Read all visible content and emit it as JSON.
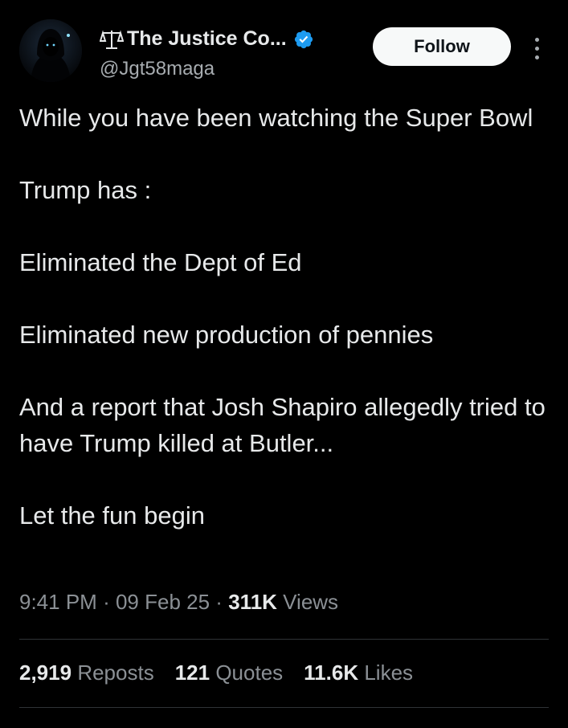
{
  "author": {
    "display_name": "The Justice Co...",
    "handle": "@Jgt58maga",
    "name_icon": "scales-of-justice-icon",
    "verified_badge": "verified-badge-icon",
    "avatar": "hooded-figure-avatar"
  },
  "actions": {
    "follow_label": "Follow",
    "more_icon": "more-vertical-icon"
  },
  "tweet": {
    "paragraphs": [
      "While you have been watching the Super Bowl",
      "Trump has :",
      "Eliminated the Dept of Ed",
      "Eliminated new production of pennies",
      "And a report that Josh Shapiro allegedly tried to have Trump killed at Butler...",
      "Let the fun begin"
    ]
  },
  "meta": {
    "time": "9:41 PM",
    "separator": "·",
    "date": "09 Feb 25",
    "views_count": "311K",
    "views_label": "Views"
  },
  "stats": {
    "reposts_count": "2,919",
    "reposts_label": "Reposts",
    "quotes_count": "121",
    "quotes_label": "Quotes",
    "likes_count": "11.6K",
    "likes_label": "Likes"
  },
  "colors": {
    "background": "#000000",
    "text_primary": "#e7e9ea",
    "text_secondary": "#8b9095",
    "verified_blue": "#1d9bf0",
    "follow_button_bg": "#f7f9f9",
    "divider": "#2f3336"
  }
}
